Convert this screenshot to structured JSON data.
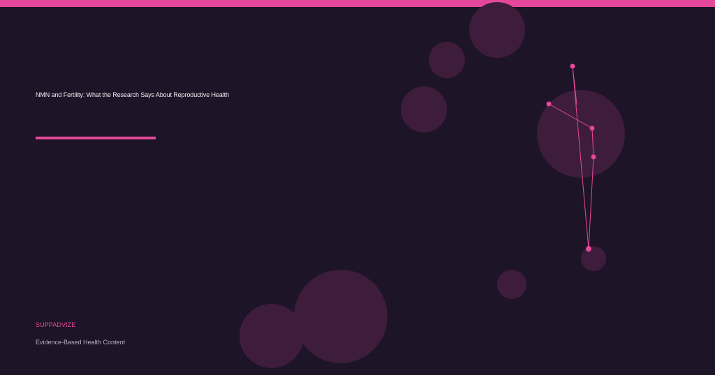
{
  "header": {
    "accent_color": "#e5489a",
    "background_color": "#1e1427"
  },
  "article": {
    "title": "NMN and Fertility: What the Research Says About Reproductive Health"
  },
  "footer": {
    "brand": "SUPPADVIZE",
    "tagline": "Evidence-Based Health Content"
  }
}
